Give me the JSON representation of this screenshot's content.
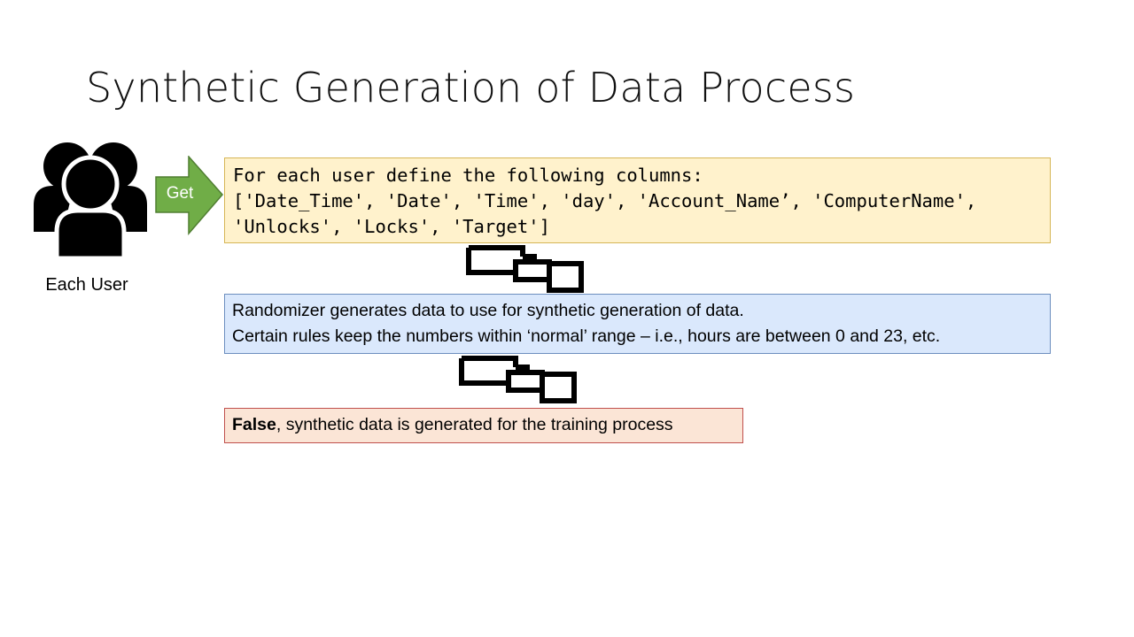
{
  "slide": {
    "title": "Synthetic Generation of Data Process"
  },
  "user_node": {
    "label": "Each User",
    "icon": "users-icon"
  },
  "get_arrow": {
    "label": "Get",
    "color": "#70ad47"
  },
  "columns_box": {
    "lines": [
      "For each user define the following columns:",
      "['Date_Time', 'Date', 'Time', 'day', 'Account_Name’, 'ComputerName',",
      "'Unlocks', 'Locks', 'Target']"
    ],
    "fill": "#fff2cc"
  },
  "randomizer_box": {
    "lines": [
      "Randomizer generates data to use for synthetic generation of data.",
      "Certain rules keep the numbers within ‘normal’ range – i.e., hours are between 0 and 23, etc."
    ],
    "fill": "#dae8fc"
  },
  "false_box": {
    "bold": "False",
    "rest": ", synthetic  data is generated for the training process",
    "fill": "#fbe5d6"
  },
  "connectors": [
    "pipe-connector-icon",
    "pipe-connector-icon"
  ]
}
